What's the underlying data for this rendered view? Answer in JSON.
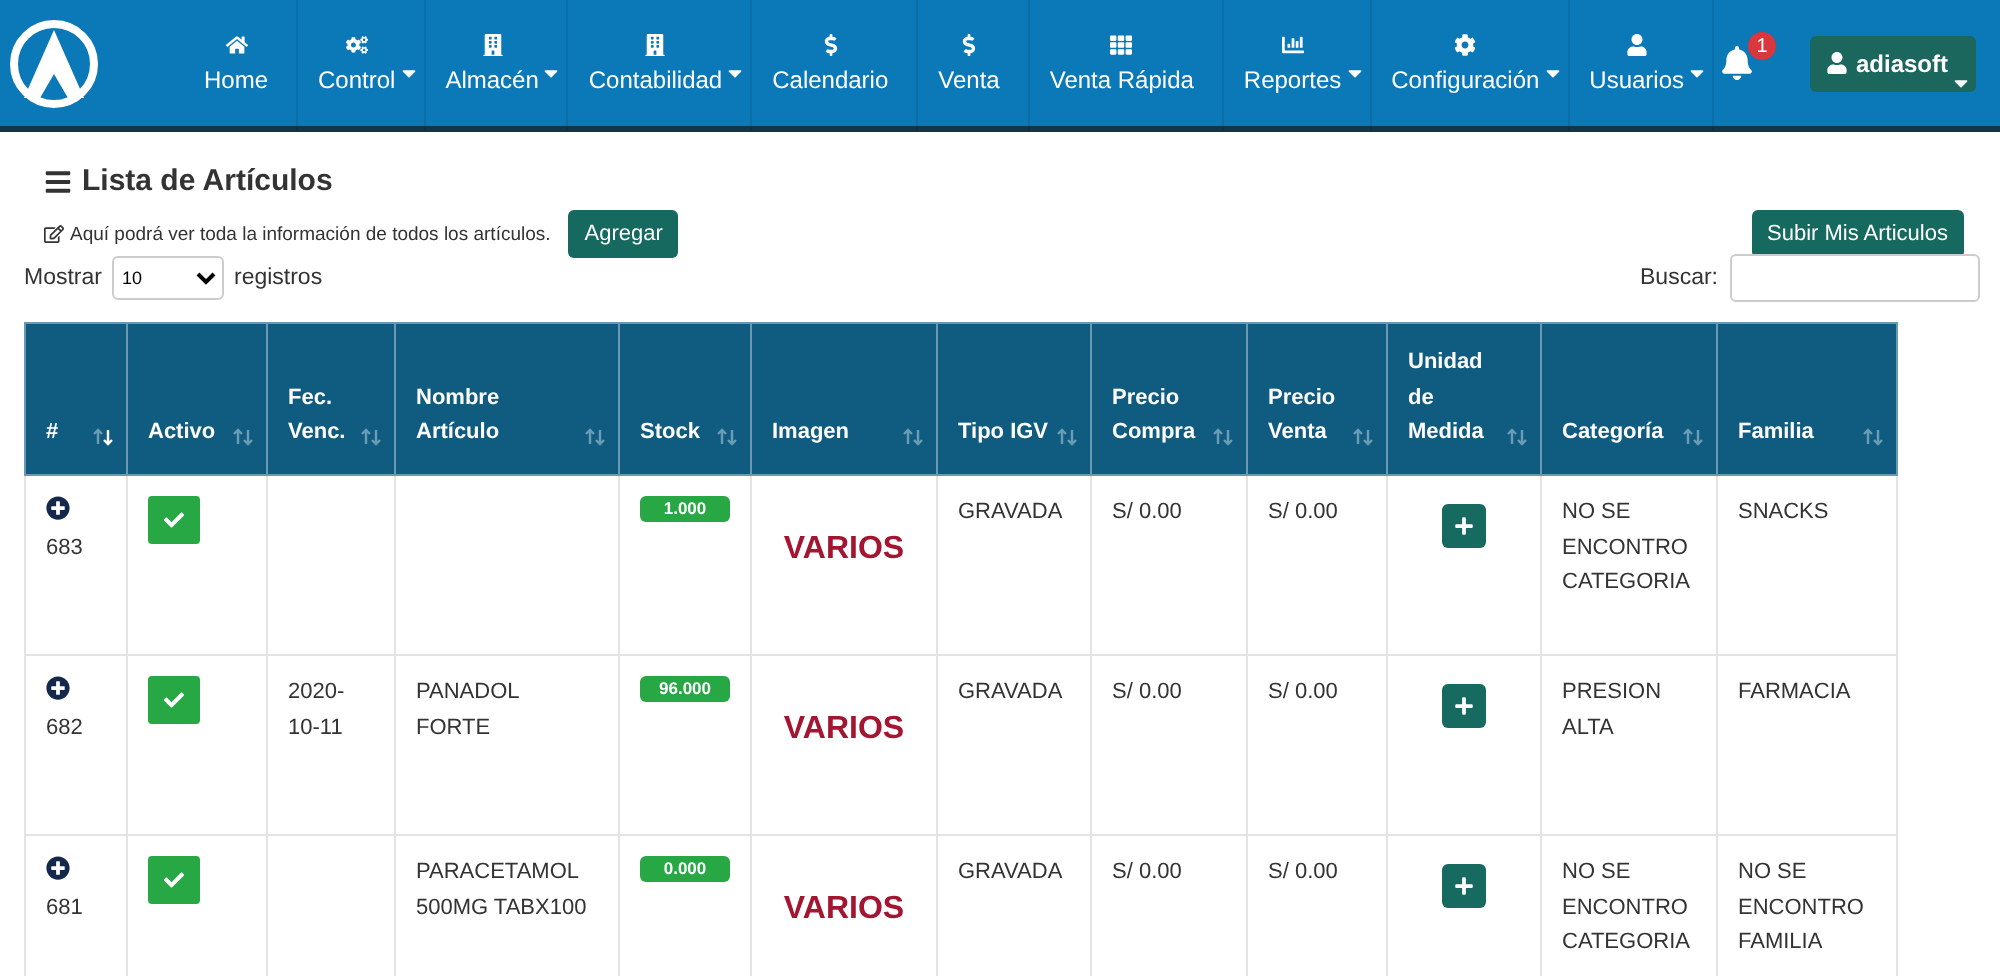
{
  "navbar": {
    "items": [
      {
        "label": "Home",
        "dropdown": false
      },
      {
        "label": "Control",
        "dropdown": true
      },
      {
        "label": "Almacén",
        "dropdown": true
      },
      {
        "label": "Contabilidad",
        "dropdown": true
      },
      {
        "label": "Calendario",
        "dropdown": false
      },
      {
        "label": "Venta",
        "dropdown": false
      },
      {
        "label": "Venta Rápida",
        "dropdown": false
      },
      {
        "label": "Reportes",
        "dropdown": true
      },
      {
        "label": "Configuración",
        "dropdown": true
      },
      {
        "label": "Usuarios",
        "dropdown": true
      }
    ],
    "notifications": "1",
    "user": "adiasoft"
  },
  "page": {
    "title": "Lista de Artículos",
    "description": "Aquí podrá ver toda la información de todos los artículos.",
    "add_button": "Agregar",
    "upload_button": "Subir Mis Articulos",
    "show_label": "Mostrar",
    "page_size": "10",
    "records_label": "registros",
    "search_label": "Buscar:"
  },
  "table": {
    "columns": [
      {
        "label": "#",
        "sorted": true
      },
      {
        "label": "Activo",
        "sorted": false
      },
      {
        "label": "Fec. Venc.",
        "sorted": false
      },
      {
        "label": "Nombre Artículo",
        "sorted": false
      },
      {
        "label": "Stock",
        "sorted": false
      },
      {
        "label": "Imagen",
        "sorted": false
      },
      {
        "label": "Tipo IGV",
        "sorted": false
      },
      {
        "label": "Precio Compra",
        "sorted": false
      },
      {
        "label": "Precio Venta",
        "sorted": false
      },
      {
        "label": "Unidad de Medida",
        "sorted": false
      },
      {
        "label": "Categoría",
        "sorted": false
      },
      {
        "label": "Familia",
        "sorted": false
      }
    ],
    "rows": [
      {
        "id": "683",
        "active": true,
        "expiry": "",
        "name": "",
        "stock": "1.000",
        "image": "VARIOS",
        "igv": "GRAVADA",
        "buy": "S/ 0.00",
        "sell": "S/ 0.00",
        "category": "NO SE ENCONTRO CATEGORIA",
        "family": "SNACKS"
      },
      {
        "id": "682",
        "active": true,
        "expiry": "2020-10-11",
        "name": "PANADOL FORTE",
        "stock": "96.000",
        "image": "VARIOS",
        "igv": "GRAVADA",
        "buy": "S/ 0.00",
        "sell": "S/ 0.00",
        "category": "PRESION ALTA",
        "family": "FARMACIA"
      },
      {
        "id": "681",
        "active": true,
        "expiry": "",
        "name": "PARACETAMOL 500MG TABX100",
        "stock": "0.000",
        "image": "VARIOS",
        "igv": "GRAVADA",
        "buy": "S/ 0.00",
        "sell": "S/ 0.00",
        "category": "NO SE ENCONTRO CATEGORIA",
        "family": "NO SE ENCONTRO FAMILIA"
      }
    ]
  }
}
